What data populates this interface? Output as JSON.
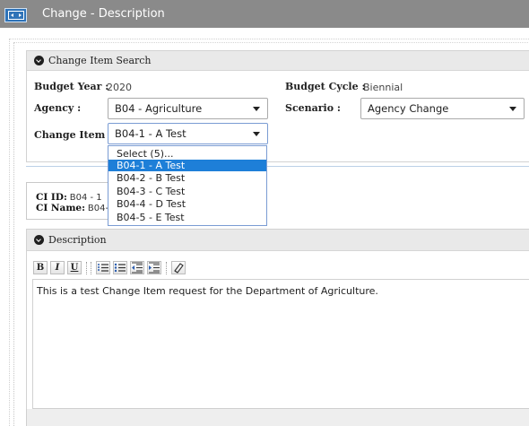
{
  "window": {
    "title": "Change - Description",
    "icon": "window-app-icon"
  },
  "search_panel": {
    "header": "Change Item Search",
    "budget_year_label": "Budget Year :",
    "budget_year_value": "2020",
    "budget_cycle_label": "Budget Cycle :",
    "budget_cycle_value": "Biennial",
    "agency_label": "Agency :",
    "agency_value": "B04 - Agriculture",
    "scenario_label": "Scenario :",
    "scenario_value": "Agency Change",
    "change_item_label": "Change Item :",
    "change_item_value": "B04-1 - A Test",
    "change_item_options": [
      "Select (5)...",
      "B04-1 - A Test",
      "B04-2 - B Test",
      "B04-3 - C Test",
      "B04-4 - D Test",
      "B04-5 - E Test"
    ],
    "selected_option_index": 1
  },
  "ci_info": {
    "id_label": "CI ID:",
    "id_value": "B04 - 1",
    "name_label": "CI Name:",
    "name_value": "B04-1"
  },
  "description_panel": {
    "header": "Description",
    "toolbar": {
      "bold": "B",
      "italic": "I",
      "underline": "U",
      "icons": [
        "bold-icon",
        "italic-icon",
        "underline-icon",
        "ordered-list-icon",
        "unordered-list-icon",
        "outdent-icon",
        "indent-icon",
        "eraser-icon"
      ]
    },
    "body_text": "This is a test Change Item request for the Department of Agriculture."
  },
  "colors": {
    "titlebar": "#8a8a8a",
    "selection": "#1e7fd8",
    "panel_header": "#e9e9e9"
  }
}
